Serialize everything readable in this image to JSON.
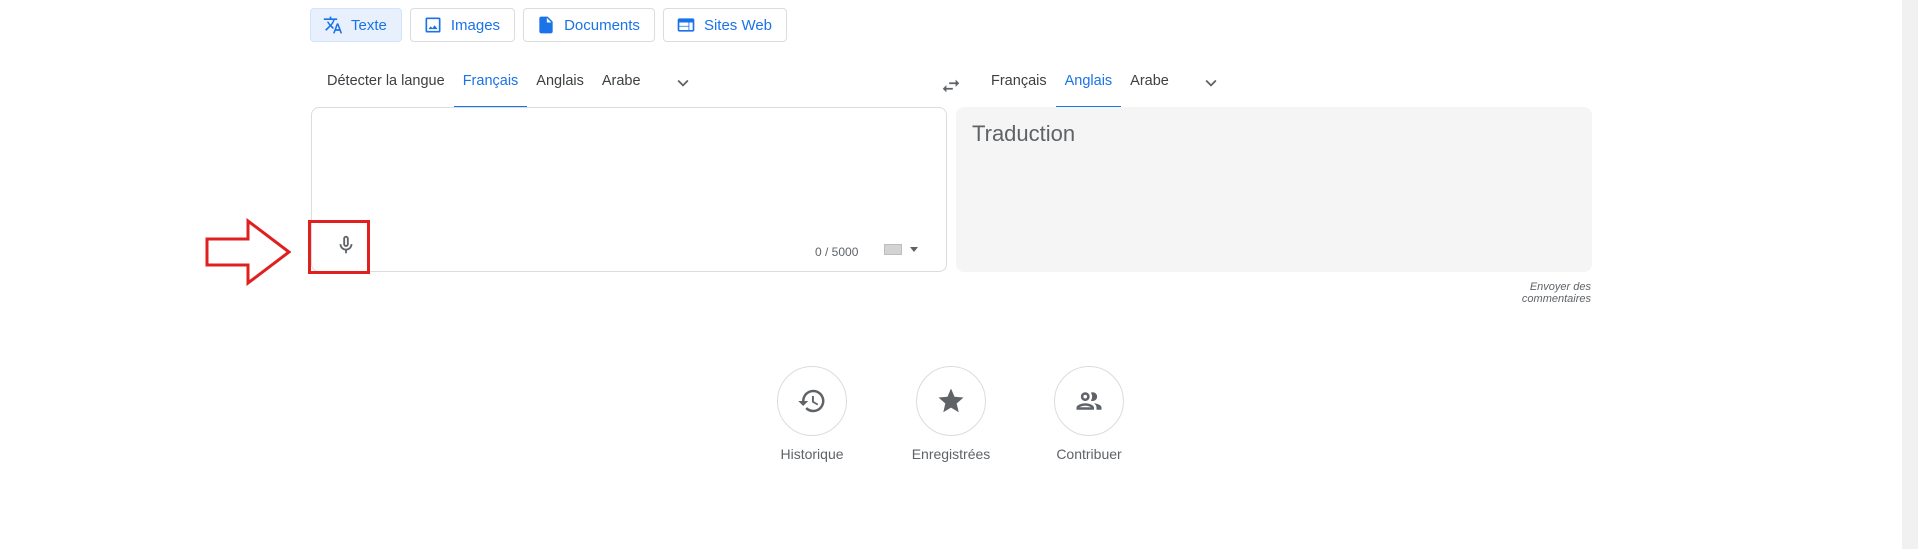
{
  "modes": [
    {
      "label": "Texte",
      "icon": "translate-icon",
      "active": true
    },
    {
      "label": "Images",
      "icon": "image-icon"
    },
    {
      "label": "Documents",
      "icon": "document-icon"
    },
    {
      "label": "Sites Web",
      "icon": "web-icon"
    }
  ],
  "source_langs": [
    "Détecter la langue",
    "Français",
    "Anglais",
    "Arabe"
  ],
  "source_active": "Français",
  "target_langs": [
    "Français",
    "Anglais",
    "Arabe"
  ],
  "target_active": "Anglais",
  "source": {
    "value": "",
    "counter": "0 / 5000"
  },
  "target": {
    "placeholder": "Traduction"
  },
  "feedback": "Envoyer des commentaires",
  "actions": [
    {
      "label": "Historique",
      "icon": "history-icon"
    },
    {
      "label": "Enregistrées",
      "icon": "star-icon"
    },
    {
      "label": "Contribuer",
      "icon": "people-icon"
    }
  ],
  "colors": {
    "accent": "#1a73e8",
    "annotation": "#e0201f"
  }
}
